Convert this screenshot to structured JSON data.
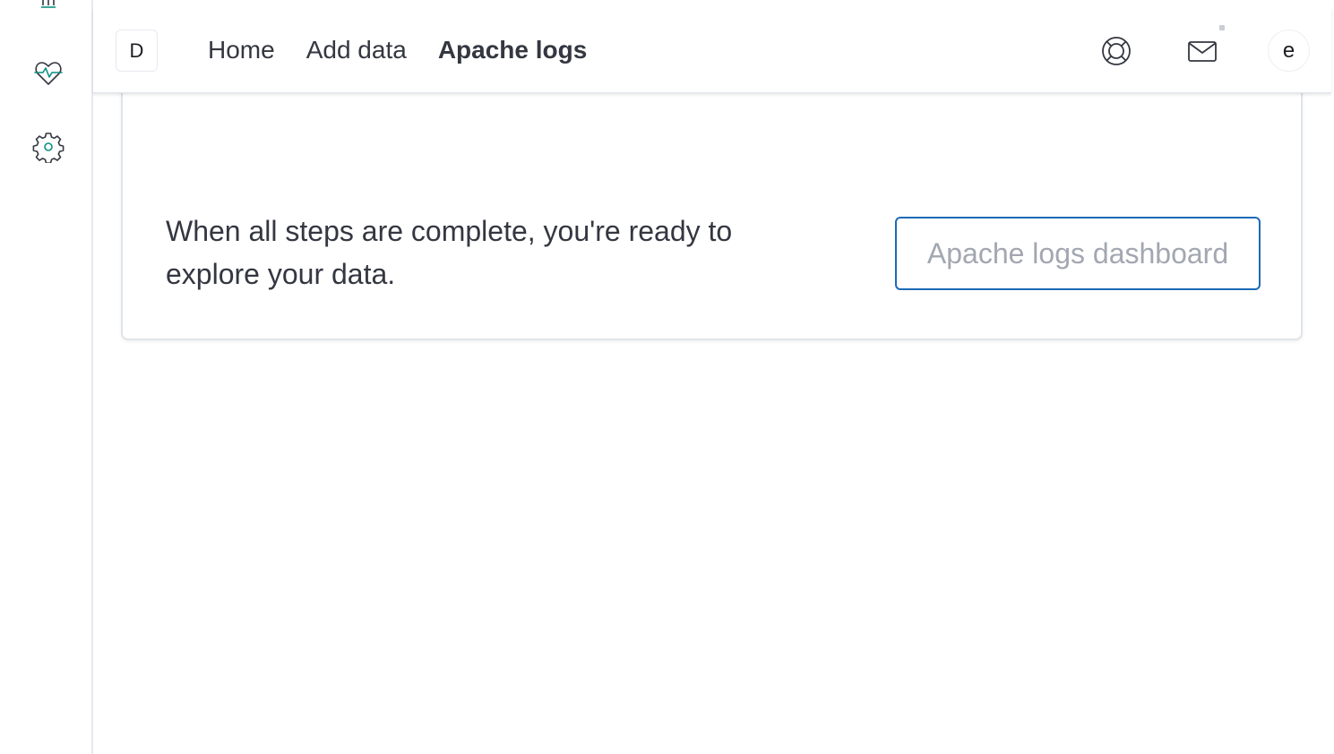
{
  "header": {
    "space_initial": "D",
    "breadcrumbs": [
      {
        "label": "Home"
      },
      {
        "label": "Add data"
      },
      {
        "label": "Apache logs"
      }
    ],
    "help_icon": "help-lifebuoy-icon",
    "news_icon": "envelope-icon",
    "user_initial": "e"
  },
  "side_nav": {
    "items": [
      {
        "icon": "observability-icon"
      },
      {
        "icon": "heartbeat-icon"
      },
      {
        "icon": "gear-icon"
      }
    ]
  },
  "main": {
    "completion_text": "When all steps are complete, you're ready to explore your data.",
    "dashboard_button_label": "Apache logs dashboard"
  },
  "colors": {
    "accent_blue": "#1c6ab8",
    "icon_teal": "#0b8f80",
    "text_dark": "#343741",
    "disabled_text": "#a2a7b1"
  }
}
